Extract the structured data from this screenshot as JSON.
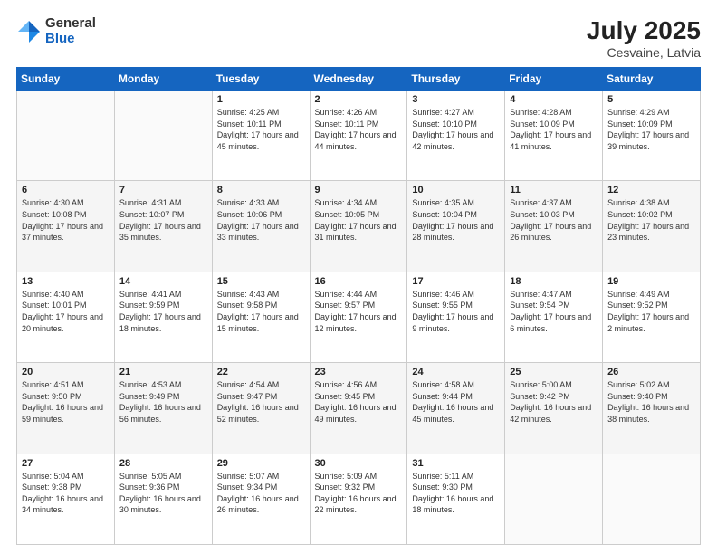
{
  "header": {
    "logo_general": "General",
    "logo_blue": "Blue",
    "month_year": "July 2025",
    "location": "Cesvaine, Latvia"
  },
  "days_of_week": [
    "Sunday",
    "Monday",
    "Tuesday",
    "Wednesday",
    "Thursday",
    "Friday",
    "Saturday"
  ],
  "weeks": [
    [
      {
        "day": "",
        "info": ""
      },
      {
        "day": "",
        "info": ""
      },
      {
        "day": "1",
        "info": "Sunrise: 4:25 AM\nSunset: 10:11 PM\nDaylight: 17 hours and 45 minutes."
      },
      {
        "day": "2",
        "info": "Sunrise: 4:26 AM\nSunset: 10:11 PM\nDaylight: 17 hours and 44 minutes."
      },
      {
        "day": "3",
        "info": "Sunrise: 4:27 AM\nSunset: 10:10 PM\nDaylight: 17 hours and 42 minutes."
      },
      {
        "day": "4",
        "info": "Sunrise: 4:28 AM\nSunset: 10:09 PM\nDaylight: 17 hours and 41 minutes."
      },
      {
        "day": "5",
        "info": "Sunrise: 4:29 AM\nSunset: 10:09 PM\nDaylight: 17 hours and 39 minutes."
      }
    ],
    [
      {
        "day": "6",
        "info": "Sunrise: 4:30 AM\nSunset: 10:08 PM\nDaylight: 17 hours and 37 minutes."
      },
      {
        "day": "7",
        "info": "Sunrise: 4:31 AM\nSunset: 10:07 PM\nDaylight: 17 hours and 35 minutes."
      },
      {
        "day": "8",
        "info": "Sunrise: 4:33 AM\nSunset: 10:06 PM\nDaylight: 17 hours and 33 minutes."
      },
      {
        "day": "9",
        "info": "Sunrise: 4:34 AM\nSunset: 10:05 PM\nDaylight: 17 hours and 31 minutes."
      },
      {
        "day": "10",
        "info": "Sunrise: 4:35 AM\nSunset: 10:04 PM\nDaylight: 17 hours and 28 minutes."
      },
      {
        "day": "11",
        "info": "Sunrise: 4:37 AM\nSunset: 10:03 PM\nDaylight: 17 hours and 26 minutes."
      },
      {
        "day": "12",
        "info": "Sunrise: 4:38 AM\nSunset: 10:02 PM\nDaylight: 17 hours and 23 minutes."
      }
    ],
    [
      {
        "day": "13",
        "info": "Sunrise: 4:40 AM\nSunset: 10:01 PM\nDaylight: 17 hours and 20 minutes."
      },
      {
        "day": "14",
        "info": "Sunrise: 4:41 AM\nSunset: 9:59 PM\nDaylight: 17 hours and 18 minutes."
      },
      {
        "day": "15",
        "info": "Sunrise: 4:43 AM\nSunset: 9:58 PM\nDaylight: 17 hours and 15 minutes."
      },
      {
        "day": "16",
        "info": "Sunrise: 4:44 AM\nSunset: 9:57 PM\nDaylight: 17 hours and 12 minutes."
      },
      {
        "day": "17",
        "info": "Sunrise: 4:46 AM\nSunset: 9:55 PM\nDaylight: 17 hours and 9 minutes."
      },
      {
        "day": "18",
        "info": "Sunrise: 4:47 AM\nSunset: 9:54 PM\nDaylight: 17 hours and 6 minutes."
      },
      {
        "day": "19",
        "info": "Sunrise: 4:49 AM\nSunset: 9:52 PM\nDaylight: 17 hours and 2 minutes."
      }
    ],
    [
      {
        "day": "20",
        "info": "Sunrise: 4:51 AM\nSunset: 9:50 PM\nDaylight: 16 hours and 59 minutes."
      },
      {
        "day": "21",
        "info": "Sunrise: 4:53 AM\nSunset: 9:49 PM\nDaylight: 16 hours and 56 minutes."
      },
      {
        "day": "22",
        "info": "Sunrise: 4:54 AM\nSunset: 9:47 PM\nDaylight: 16 hours and 52 minutes."
      },
      {
        "day": "23",
        "info": "Sunrise: 4:56 AM\nSunset: 9:45 PM\nDaylight: 16 hours and 49 minutes."
      },
      {
        "day": "24",
        "info": "Sunrise: 4:58 AM\nSunset: 9:44 PM\nDaylight: 16 hours and 45 minutes."
      },
      {
        "day": "25",
        "info": "Sunrise: 5:00 AM\nSunset: 9:42 PM\nDaylight: 16 hours and 42 minutes."
      },
      {
        "day": "26",
        "info": "Sunrise: 5:02 AM\nSunset: 9:40 PM\nDaylight: 16 hours and 38 minutes."
      }
    ],
    [
      {
        "day": "27",
        "info": "Sunrise: 5:04 AM\nSunset: 9:38 PM\nDaylight: 16 hours and 34 minutes."
      },
      {
        "day": "28",
        "info": "Sunrise: 5:05 AM\nSunset: 9:36 PM\nDaylight: 16 hours and 30 minutes."
      },
      {
        "day": "29",
        "info": "Sunrise: 5:07 AM\nSunset: 9:34 PM\nDaylight: 16 hours and 26 minutes."
      },
      {
        "day": "30",
        "info": "Sunrise: 5:09 AM\nSunset: 9:32 PM\nDaylight: 16 hours and 22 minutes."
      },
      {
        "day": "31",
        "info": "Sunrise: 5:11 AM\nSunset: 9:30 PM\nDaylight: 16 hours and 18 minutes."
      },
      {
        "day": "",
        "info": ""
      },
      {
        "day": "",
        "info": ""
      }
    ]
  ]
}
